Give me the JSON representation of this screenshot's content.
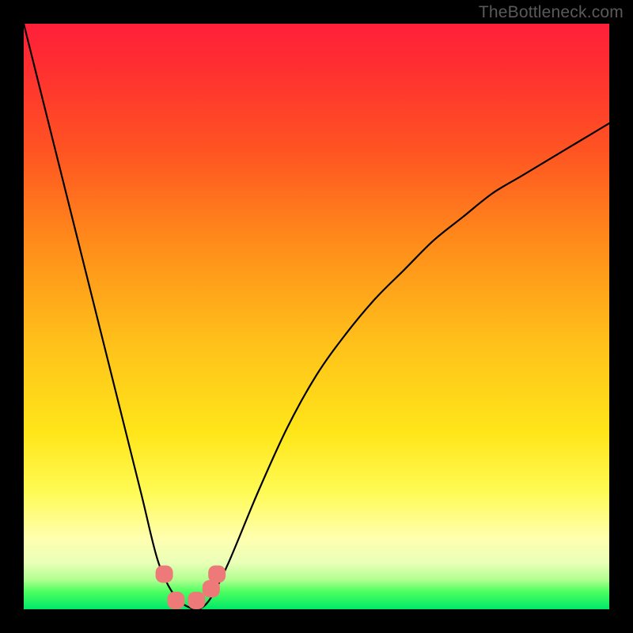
{
  "watermark": "TheBottleneck.com",
  "chart_data": {
    "type": "line",
    "title": "",
    "xlabel": "",
    "ylabel": "",
    "xlim": [
      0,
      100
    ],
    "ylim": [
      0,
      100
    ],
    "series": [
      {
        "name": "curve",
        "x": [
          0,
          5,
          10,
          15,
          20,
          23,
          26,
          29,
          30,
          32,
          35,
          40,
          45,
          50,
          55,
          60,
          65,
          70,
          75,
          80,
          85,
          90,
          95,
          100
        ],
        "values": [
          100,
          80,
          60,
          40,
          20,
          8,
          2,
          0,
          0,
          2,
          8,
          20,
          31,
          40,
          47,
          53,
          58,
          63,
          67,
          71,
          74,
          77,
          80,
          83
        ]
      }
    ],
    "markers": [
      {
        "x": 24.0,
        "y": 6.0
      },
      {
        "x": 26.0,
        "y": 1.5
      },
      {
        "x": 29.5,
        "y": 1.5
      },
      {
        "x": 32.0,
        "y": 3.5
      },
      {
        "x": 33.0,
        "y": 6.0
      }
    ],
    "marker_style": {
      "color": "#ed7a79",
      "size": 11
    },
    "gradient_colors": {
      "top": "#ff1f3a",
      "mid": "#ffe61a",
      "bottom": "#00e868"
    }
  }
}
